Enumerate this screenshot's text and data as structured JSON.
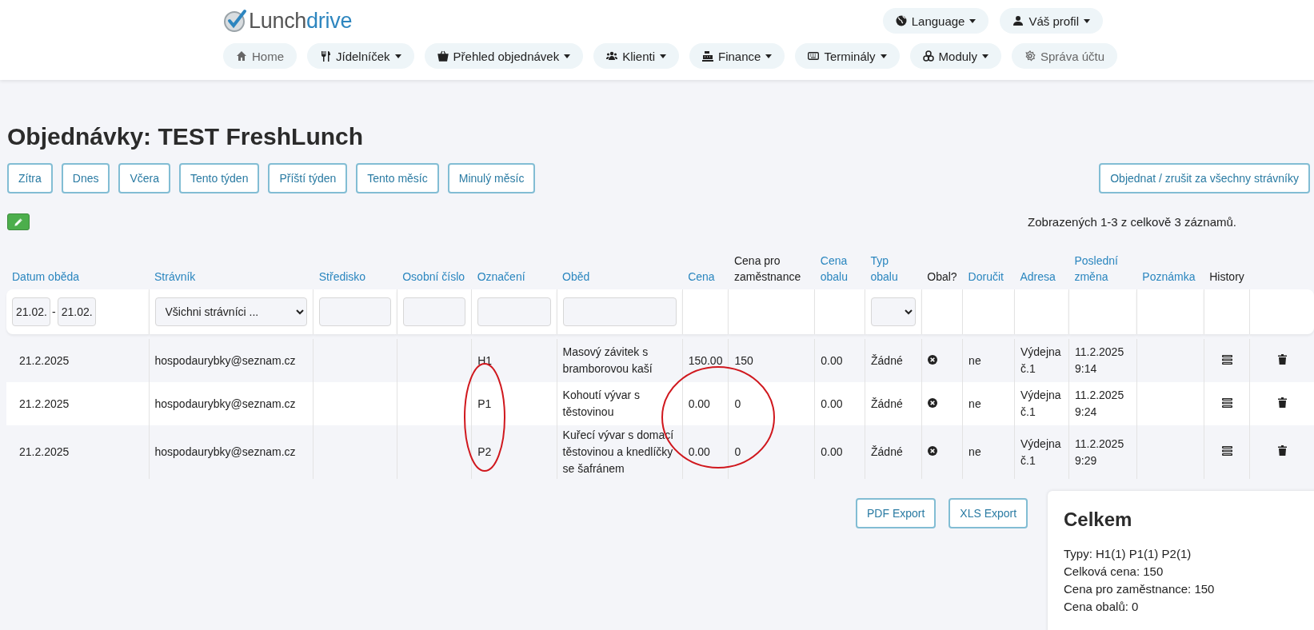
{
  "logo": {
    "text": "Lunch",
    "accent": "drive"
  },
  "top_menu": [
    {
      "label": "Language",
      "dropdown": true
    },
    {
      "label": "Váš profil",
      "dropdown": true
    }
  ],
  "nav": [
    {
      "label": "Home",
      "dropdown": false,
      "muted": true
    },
    {
      "label": "Jídelníček",
      "dropdown": true,
      "muted": false
    },
    {
      "label": "Přehled objednávek",
      "dropdown": true,
      "muted": false
    },
    {
      "label": "Klienti",
      "dropdown": true,
      "muted": false
    },
    {
      "label": "Finance",
      "dropdown": true,
      "muted": false
    },
    {
      "label": "Terminály",
      "dropdown": true,
      "muted": false
    },
    {
      "label": "Moduly",
      "dropdown": true,
      "muted": false
    },
    {
      "label": "Správa účtu",
      "dropdown": false,
      "muted": true
    }
  ],
  "title": "Objednávky: TEST FreshLunch",
  "period_buttons": [
    "Zítra",
    "Dnes",
    "Včera",
    "Tento týden",
    "Příští týden",
    "Tento měsíc",
    "Minulý měsíc"
  ],
  "bulk_button": "Objednat / zrušit za všechny strávníky",
  "record_count": "Zobrazených 1-3 z celkově 3 záznamů.",
  "table": {
    "columns": [
      {
        "label": "Datum oběda",
        "sortable": true
      },
      {
        "label": "Strávník",
        "sortable": true
      },
      {
        "label": "Středisko",
        "sortable": true
      },
      {
        "label": "Osobní číslo",
        "sortable": true
      },
      {
        "label": "Označení",
        "sortable": true
      },
      {
        "label": "Oběd",
        "sortable": true
      },
      {
        "label": "Cena",
        "sortable": true
      },
      {
        "label": "Cena pro zaměstnance",
        "sortable": false
      },
      {
        "label": "Cena obalu",
        "sortable": true
      },
      {
        "label": "Typ obalu",
        "sortable": true
      },
      {
        "label": "Obal?",
        "sortable": false
      },
      {
        "label": "Doručit",
        "sortable": true
      },
      {
        "label": "Adresa",
        "sortable": true
      },
      {
        "label": "Poslední změna",
        "sortable": true
      },
      {
        "label": "Poznámka",
        "sortable": true
      },
      {
        "label": "History",
        "sortable": false
      }
    ],
    "filters": {
      "date_from": "21.02.",
      "date_separator": "-",
      "date_to": "21.02.",
      "diner": "Všichni strávníci ..."
    },
    "rows": [
      {
        "date": "21.2.2025",
        "diner": "hospodaurybky@seznam.cz",
        "code": "H1",
        "meal": "Masový závitek s bramborovou kaší",
        "price": "150.00",
        "employee_price": "150",
        "package_price": "0.00",
        "package_type": "Žádné",
        "deliver": "ne",
        "address": "Výdejna č.1",
        "changed": "11.2.2025 9:14"
      },
      {
        "date": "21.2.2025",
        "diner": "hospodaurybky@seznam.cz",
        "code": "P1",
        "meal": "Kohoutí vývar s těstovinou",
        "price": "0.00",
        "employee_price": "0",
        "package_price": "0.00",
        "package_type": "Žádné",
        "deliver": "ne",
        "address": "Výdejna č.1",
        "changed": "11.2.2025 9:24"
      },
      {
        "date": "21.2.2025",
        "diner": "hospodaurybky@seznam.cz",
        "code": "P2",
        "meal": "Kuřecí vývar s domací těstovinou a knedlíčky se šafránem",
        "price": "0.00",
        "employee_price": "0",
        "package_price": "0.00",
        "package_type": "Žádné",
        "deliver": "ne",
        "address": "Výdejna č.1",
        "changed": "11.2.2025 9:29"
      }
    ]
  },
  "export_buttons": [
    "PDF Export",
    "XLS Export"
  ],
  "summary": {
    "title": "Celkem",
    "lines": [
      "Typy: H1(1) P1(1) P2(1)",
      "Celková cena: 150",
      "Cena pro zaměstnance: 150",
      "Cena obalů: 0"
    ]
  }
}
